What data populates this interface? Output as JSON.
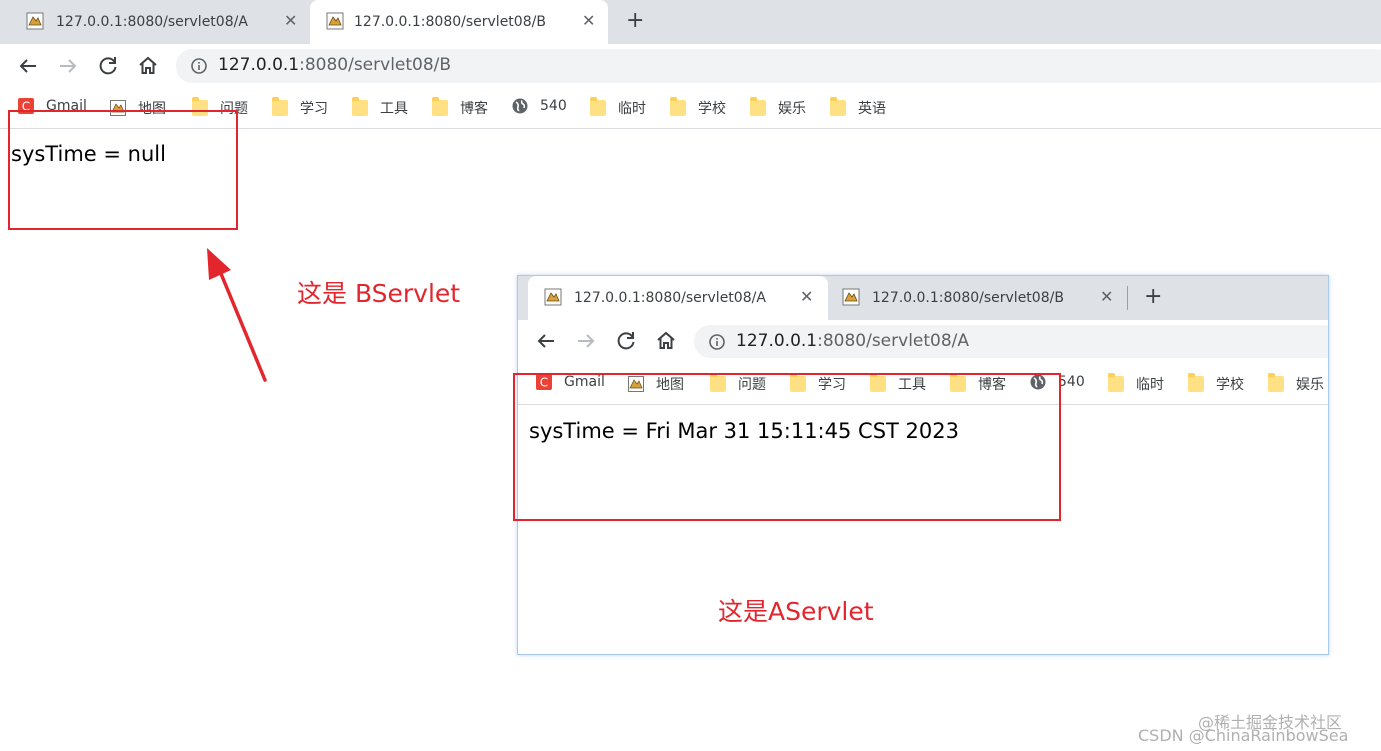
{
  "main_window": {
    "tabs": [
      {
        "title": "127.0.0.1:8080/servlet08/A",
        "active": false
      },
      {
        "title": "127.0.0.1:8080/servlet08/B",
        "active": true
      }
    ],
    "url_host": "127.0.0.1",
    "url_path": ":8080/servlet08/B",
    "bookmarks": [
      {
        "label": "Gmail",
        "icon": "gmail-icon"
      },
      {
        "label": "地图",
        "icon": "map-icon"
      },
      {
        "label": "问题",
        "icon": "folder-icon"
      },
      {
        "label": "学习",
        "icon": "folder-icon"
      },
      {
        "label": "工具",
        "icon": "folder-icon"
      },
      {
        "label": "博客",
        "icon": "folder-icon"
      },
      {
        "label": "540",
        "icon": "globe-icon"
      },
      {
        "label": "临时",
        "icon": "folder-icon"
      },
      {
        "label": "学校",
        "icon": "folder-icon"
      },
      {
        "label": "娱乐",
        "icon": "folder-icon"
      },
      {
        "label": "英语",
        "icon": "folder-icon"
      }
    ],
    "content_text": "sysTime = null"
  },
  "inset_window": {
    "tabs": [
      {
        "title": "127.0.0.1:8080/servlet08/A",
        "active": true
      },
      {
        "title": "127.0.0.1:8080/servlet08/B",
        "active": false
      }
    ],
    "url_host": "127.0.0.1",
    "url_path": ":8080/servlet08/A",
    "bookmarks": [
      {
        "label": "Gmail",
        "icon": "gmail-icon"
      },
      {
        "label": "地图",
        "icon": "map-icon"
      },
      {
        "label": "问题",
        "icon": "folder-icon"
      },
      {
        "label": "学习",
        "icon": "folder-icon"
      },
      {
        "label": "工具",
        "icon": "folder-icon"
      },
      {
        "label": "博客",
        "icon": "folder-icon"
      },
      {
        "label": "540",
        "icon": "globe-icon"
      },
      {
        "label": "临时",
        "icon": "folder-icon"
      },
      {
        "label": "学校",
        "icon": "folder-icon"
      },
      {
        "label": "娱乐",
        "icon": "folder-icon"
      }
    ],
    "content_text": "sysTime = Fri Mar 31 15:11:45 CST 2023"
  },
  "annotations": {
    "b_servlet": "这是 BServlet",
    "a_servlet": "这是AServlet"
  },
  "watermark": {
    "line1": "@稀土掘金技术社区",
    "line2": "CSDN @ChinaRainbowSea"
  },
  "colors": {
    "annotation_red": "#e3262d",
    "tabstrip_bg": "#dee1e6",
    "omnibox_bg": "#f1f3f4",
    "folder_yellow": "#ffe082",
    "gmail_red": "#ea4335"
  }
}
